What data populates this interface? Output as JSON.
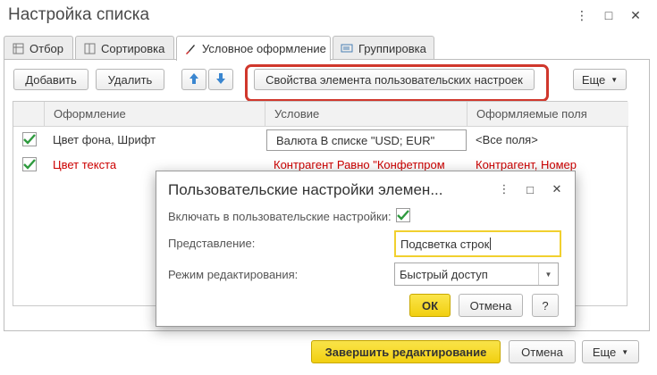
{
  "window": {
    "title": "Настройка списка",
    "more_icon": "⋮",
    "maximize_icon": "□",
    "close_icon": "✕"
  },
  "tabs": [
    {
      "label": "Отбор",
      "icon": "filter-icon"
    },
    {
      "label": "Сортировка",
      "icon": "sort-icon"
    },
    {
      "label": "Условное оформление",
      "icon": "brush-icon"
    },
    {
      "label": "Группировка",
      "icon": "group-icon"
    }
  ],
  "toolbar": {
    "add_label": "Добавить",
    "delete_label": "Удалить",
    "up_icon": "arrow-up-icon",
    "down_icon": "arrow-down-icon",
    "properties_label": "Свойства элемента пользовательских настроек",
    "more_label": "Еще"
  },
  "grid": {
    "columns": [
      "Оформление",
      "Условие",
      "Оформляемые поля"
    ],
    "rows": [
      {
        "checked": true,
        "appearance": "Цвет фона, Шрифт",
        "condition": "Валюта В списке \"USD; EUR\"",
        "fields": "<Все поля>",
        "red": false
      },
      {
        "checked": true,
        "appearance": "Цвет текста",
        "condition": "Контрагент Равно \"Конфетпром",
        "fields": "Контрагент, Номер",
        "red": true
      }
    ]
  },
  "dialog": {
    "title": "Пользовательские настройки элемен...",
    "include_label": "Включать в пользовательские настройки:",
    "include_checked": true,
    "presentation_label": "Представление:",
    "presentation_value": "Подсветка строк",
    "mode_label": "Режим редактирования:",
    "mode_value": "Быстрый доступ",
    "ok_label": "ОК",
    "cancel_label": "Отмена",
    "help_label": "?"
  },
  "footer": {
    "finish_label": "Завершить редактирование",
    "cancel_label": "Отмена",
    "more_label": "Еще"
  },
  "colors": {
    "accent_yellow": "#f1cf10",
    "highlight_red": "#d0372c",
    "check_green": "#2e9a3e",
    "red_text": "#cc0000"
  }
}
